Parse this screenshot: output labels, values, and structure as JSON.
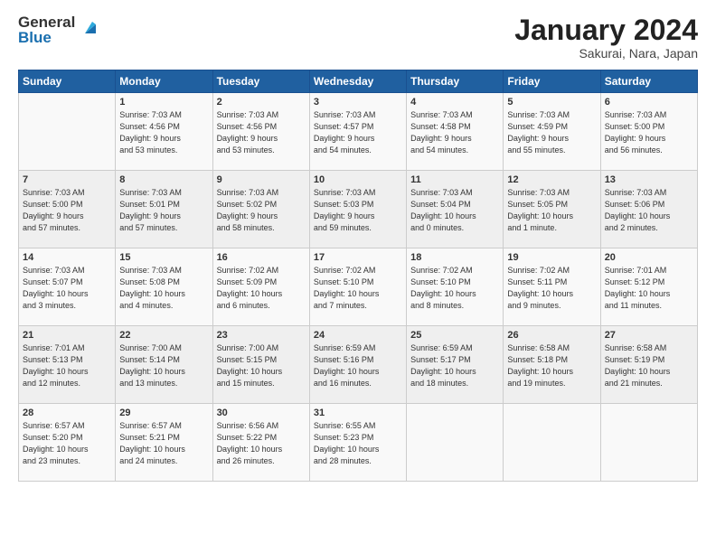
{
  "header": {
    "logo_general": "General",
    "logo_blue": "Blue",
    "title": "January 2024",
    "subtitle": "Sakurai, Nara, Japan"
  },
  "days_of_week": [
    "Sunday",
    "Monday",
    "Tuesday",
    "Wednesday",
    "Thursday",
    "Friday",
    "Saturday"
  ],
  "weeks": [
    [
      {
        "day": "",
        "info": ""
      },
      {
        "day": "1",
        "info": "Sunrise: 7:03 AM\nSunset: 4:56 PM\nDaylight: 9 hours\nand 53 minutes."
      },
      {
        "day": "2",
        "info": "Sunrise: 7:03 AM\nSunset: 4:56 PM\nDaylight: 9 hours\nand 53 minutes."
      },
      {
        "day": "3",
        "info": "Sunrise: 7:03 AM\nSunset: 4:57 PM\nDaylight: 9 hours\nand 54 minutes."
      },
      {
        "day": "4",
        "info": "Sunrise: 7:03 AM\nSunset: 4:58 PM\nDaylight: 9 hours\nand 54 minutes."
      },
      {
        "day": "5",
        "info": "Sunrise: 7:03 AM\nSunset: 4:59 PM\nDaylight: 9 hours\nand 55 minutes."
      },
      {
        "day": "6",
        "info": "Sunrise: 7:03 AM\nSunset: 5:00 PM\nDaylight: 9 hours\nand 56 minutes."
      }
    ],
    [
      {
        "day": "7",
        "info": "Sunrise: 7:03 AM\nSunset: 5:00 PM\nDaylight: 9 hours\nand 57 minutes."
      },
      {
        "day": "8",
        "info": "Sunrise: 7:03 AM\nSunset: 5:01 PM\nDaylight: 9 hours\nand 57 minutes."
      },
      {
        "day": "9",
        "info": "Sunrise: 7:03 AM\nSunset: 5:02 PM\nDaylight: 9 hours\nand 58 minutes."
      },
      {
        "day": "10",
        "info": "Sunrise: 7:03 AM\nSunset: 5:03 PM\nDaylight: 9 hours\nand 59 minutes."
      },
      {
        "day": "11",
        "info": "Sunrise: 7:03 AM\nSunset: 5:04 PM\nDaylight: 10 hours\nand 0 minutes."
      },
      {
        "day": "12",
        "info": "Sunrise: 7:03 AM\nSunset: 5:05 PM\nDaylight: 10 hours\nand 1 minute."
      },
      {
        "day": "13",
        "info": "Sunrise: 7:03 AM\nSunset: 5:06 PM\nDaylight: 10 hours\nand 2 minutes."
      }
    ],
    [
      {
        "day": "14",
        "info": "Sunrise: 7:03 AM\nSunset: 5:07 PM\nDaylight: 10 hours\nand 3 minutes."
      },
      {
        "day": "15",
        "info": "Sunrise: 7:03 AM\nSunset: 5:08 PM\nDaylight: 10 hours\nand 4 minutes."
      },
      {
        "day": "16",
        "info": "Sunrise: 7:02 AM\nSunset: 5:09 PM\nDaylight: 10 hours\nand 6 minutes."
      },
      {
        "day": "17",
        "info": "Sunrise: 7:02 AM\nSunset: 5:10 PM\nDaylight: 10 hours\nand 7 minutes."
      },
      {
        "day": "18",
        "info": "Sunrise: 7:02 AM\nSunset: 5:10 PM\nDaylight: 10 hours\nand 8 minutes."
      },
      {
        "day": "19",
        "info": "Sunrise: 7:02 AM\nSunset: 5:11 PM\nDaylight: 10 hours\nand 9 minutes."
      },
      {
        "day": "20",
        "info": "Sunrise: 7:01 AM\nSunset: 5:12 PM\nDaylight: 10 hours\nand 11 minutes."
      }
    ],
    [
      {
        "day": "21",
        "info": "Sunrise: 7:01 AM\nSunset: 5:13 PM\nDaylight: 10 hours\nand 12 minutes."
      },
      {
        "day": "22",
        "info": "Sunrise: 7:00 AM\nSunset: 5:14 PM\nDaylight: 10 hours\nand 13 minutes."
      },
      {
        "day": "23",
        "info": "Sunrise: 7:00 AM\nSunset: 5:15 PM\nDaylight: 10 hours\nand 15 minutes."
      },
      {
        "day": "24",
        "info": "Sunrise: 6:59 AM\nSunset: 5:16 PM\nDaylight: 10 hours\nand 16 minutes."
      },
      {
        "day": "25",
        "info": "Sunrise: 6:59 AM\nSunset: 5:17 PM\nDaylight: 10 hours\nand 18 minutes."
      },
      {
        "day": "26",
        "info": "Sunrise: 6:58 AM\nSunset: 5:18 PM\nDaylight: 10 hours\nand 19 minutes."
      },
      {
        "day": "27",
        "info": "Sunrise: 6:58 AM\nSunset: 5:19 PM\nDaylight: 10 hours\nand 21 minutes."
      }
    ],
    [
      {
        "day": "28",
        "info": "Sunrise: 6:57 AM\nSunset: 5:20 PM\nDaylight: 10 hours\nand 23 minutes."
      },
      {
        "day": "29",
        "info": "Sunrise: 6:57 AM\nSunset: 5:21 PM\nDaylight: 10 hours\nand 24 minutes."
      },
      {
        "day": "30",
        "info": "Sunrise: 6:56 AM\nSunset: 5:22 PM\nDaylight: 10 hours\nand 26 minutes."
      },
      {
        "day": "31",
        "info": "Sunrise: 6:55 AM\nSunset: 5:23 PM\nDaylight: 10 hours\nand 28 minutes."
      },
      {
        "day": "",
        "info": ""
      },
      {
        "day": "",
        "info": ""
      },
      {
        "day": "",
        "info": ""
      }
    ]
  ]
}
